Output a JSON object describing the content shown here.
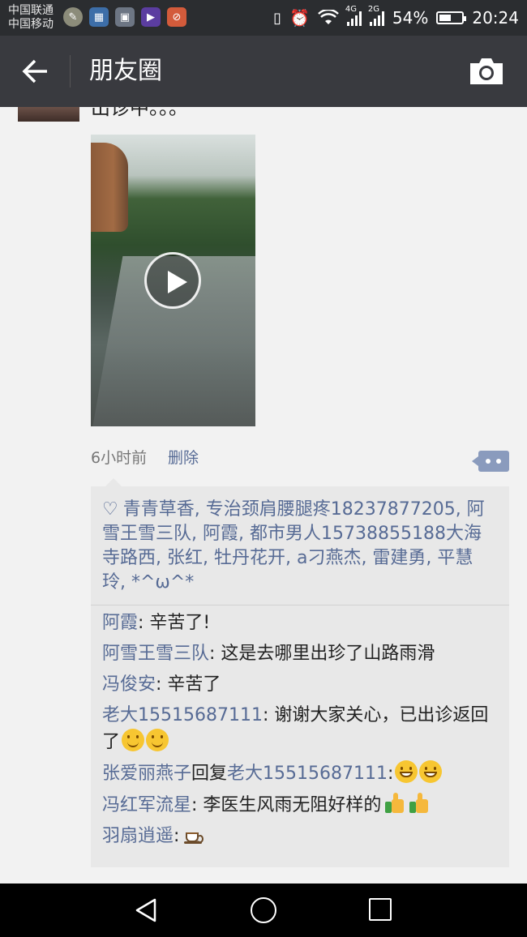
{
  "status_bar": {
    "carrier1": "中国联通",
    "carrier2": "中国移动",
    "net1": "4G",
    "net2": "2G",
    "battery": "54%",
    "battery_level": 0.54,
    "time": "20:24"
  },
  "header": {
    "title": "朋友圈"
  },
  "post": {
    "text_fragment": "出诊中。。。",
    "time_ago": "6小时前",
    "delete_label": "删除"
  },
  "likes": {
    "text": "青青草香, 专治颈肩腰腿疼18237877205, 阿雪王雪三队, 阿霞, 都市男人15738855188大海寺路西, 张红, 牡丹花开, a刁燕杰, 雷建勇, 平慧玲, *^ω^*"
  },
  "comments": [
    {
      "name": "阿霞",
      "text": ": 辛苦了!"
    },
    {
      "name": "阿雪王雪三队",
      "text": ": 这是去哪里出珍了山路雨滑"
    },
    {
      "name": "冯俊安",
      "text": ": 辛苦了"
    },
    {
      "name": "老大15515687111",
      "text": ": 谢谢大家关心，已出诊返回了"
    },
    {
      "name": "张爱丽燕子",
      "reply_word": "回复",
      "reply_to": "老大15515687111",
      "text": ":"
    },
    {
      "name": "冯红军流星",
      "text": ": 李医生风雨无阻好样的"
    },
    {
      "name": "羽扇逍遥",
      "text": ":"
    }
  ],
  "icons": {
    "back": "arrow-left-icon",
    "camera": "camera-icon",
    "play": "play-icon",
    "more": "comment-more-icon",
    "heart": "heart-icon"
  },
  "colors": {
    "link": "#576b95",
    "titlebar": "#393a3f"
  }
}
